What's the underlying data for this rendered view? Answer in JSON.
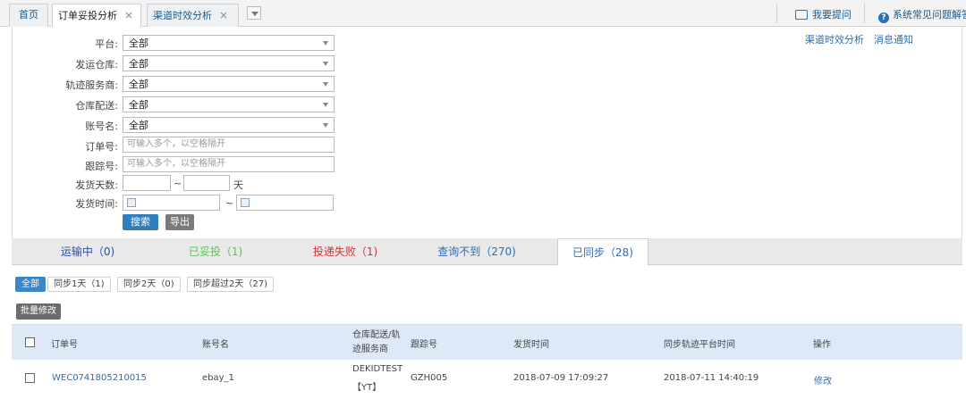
{
  "tabs": {
    "home": "首页",
    "order_analysis": "订单妥投分析",
    "channel_analysis": "渠道时效分析",
    "ask": "我要提问",
    "faq": "系统常见问题解答"
  },
  "form": {
    "platform_label": "平台:",
    "platform_value": "全部",
    "warehouse_label": "发运仓库:",
    "warehouse_value": "全部",
    "tracking_provider_label": "轨迹服务商:",
    "tracking_provider_value": "全部",
    "warehouse_delivery_label": "仓库配送:",
    "warehouse_delivery_value": "全部",
    "account_label": "账号名:",
    "account_value": "全部",
    "order_no_label": "订单号:",
    "order_no_placeholder": "可输入多个，以空格隔开",
    "tracking_no_label": "跟踪号:",
    "tracking_no_placeholder": "可输入多个，以空格隔开",
    "ship_days_label": "发货天数:",
    "range_sep": "~",
    "days_unit": "天",
    "ship_time_label": "发货时间:",
    "search_btn": "搜索",
    "export_btn": "导出"
  },
  "right_links": {
    "channel": "渠道时效分析",
    "notice": "消息通知"
  },
  "status_tabs": [
    {
      "label": "运输中（0)",
      "color": "#2b4fa6"
    },
    {
      "label": "已妥投（1)",
      "color": "#5ac45a"
    },
    {
      "label": "投递失败（1)",
      "color": "#d33333"
    },
    {
      "label": "查询不到（270)",
      "color": "#2c6fb3"
    },
    {
      "label": "已同步（28)",
      "color": "#2c6fb3"
    }
  ],
  "filters": [
    "全部",
    "同步1天（1)",
    "同步2天（0)",
    "同步超过2天（27)"
  ],
  "batch_btn": "批量修改",
  "table": {
    "headers": {
      "order_no": "订单号",
      "account": "账号名",
      "delivery_provider_1": "仓库配送/轨",
      "delivery_provider_2": "迹服务商",
      "tracking_no": "跟踪号",
      "ship_time": "发货时间",
      "sync_time": "同步轨迹平台时间",
      "action": "操作"
    },
    "rows": [
      {
        "order_no": "WEC0741805210015",
        "account": "ebay_1",
        "provider_1": "DEKIDTEST",
        "provider_2": "【YT】",
        "tracking_no": "GZH005",
        "ship_time": "2018-07-09 17:09:27",
        "sync_time": "2018-07-11 14:40:19",
        "action": "修改"
      }
    ]
  }
}
